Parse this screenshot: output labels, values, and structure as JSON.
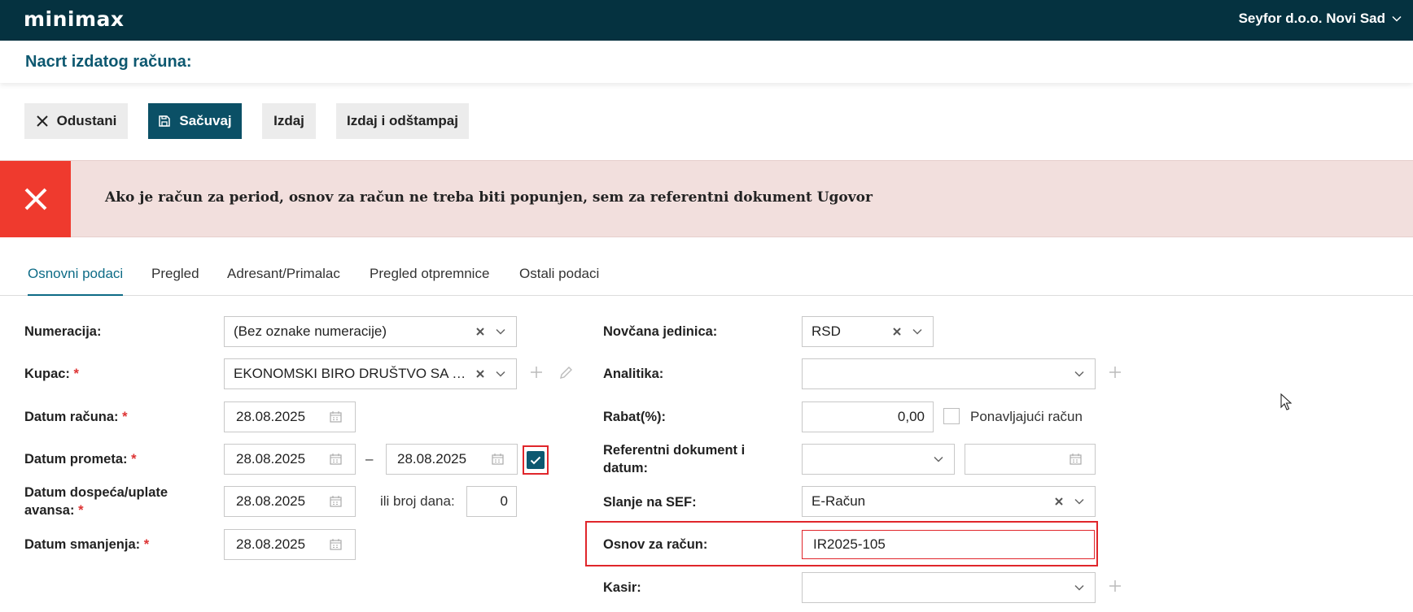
{
  "app": {
    "logo": "minimax",
    "company": "Seyfor d.o.o. Novi Sad",
    "page_title": "Nacrt izdatog računa:"
  },
  "toolbar": {
    "cancel_label": "Odustani",
    "save_label": "Sačuvaj",
    "issue_label": "Izdaj",
    "issue_print_label": "Izdaj i odštampaj"
  },
  "error": {
    "message": "Ako je račun za period, osnov za račun ne treba biti popunjen, sem za referentni dokument Ugovor"
  },
  "tabs": [
    {
      "label": "Osnovni podaci",
      "active": true
    },
    {
      "label": "Pregled",
      "active": false
    },
    {
      "label": "Adresant/Primalac",
      "active": false
    },
    {
      "label": "Pregled otpremnice",
      "active": false
    },
    {
      "label": "Ostali podaci",
      "active": false
    }
  ],
  "form": {
    "numeracija": {
      "label": "Numeracija:",
      "value": "(Bez oznake numeracije)"
    },
    "kupac": {
      "label": "Kupac:",
      "required": "*",
      "value": "EKONOMSKI BIRO DRUŠTVO SA OGR..."
    },
    "datum_racuna": {
      "label": "Datum računa:",
      "required": "*",
      "value": "28.08.2025"
    },
    "datum_prometa": {
      "label": "Datum prometa:",
      "required": "*",
      "from": "28.08.2025",
      "separator": "–",
      "to": "28.08.2025",
      "checked": true
    },
    "datum_dospeca": {
      "label_line1": "Datum dospeća/uplate",
      "label_line2": "avansa:",
      "required": "*",
      "value": "28.08.2025",
      "days_label": "ili broj dana:",
      "days": "0"
    },
    "datum_smanjenja": {
      "label": "Datum smanjenja:",
      "required": "*",
      "value": "28.08.2025"
    },
    "novcana_jedinica": {
      "label": "Novčana jedinica:",
      "value": "RSD"
    },
    "analitika": {
      "label": "Analitika:",
      "value": ""
    },
    "rabat": {
      "label": "Rabat(%):",
      "value": "0,00",
      "recurring_label": "Ponavljajući račun",
      "recurring_checked": false
    },
    "referentni": {
      "label_line1": "Referentni dokument i",
      "label_line2": "datum:",
      "value": "",
      "date": ""
    },
    "slanje_sef": {
      "label": "Slanje na SEF:",
      "value": "E-Račun"
    },
    "osnov": {
      "label": "Osnov za račun:",
      "value": "IR2025-105"
    },
    "kasir": {
      "label": "Kasir:",
      "value": ""
    }
  },
  "colors": {
    "topbar": "#053240",
    "primary": "#0b5066",
    "accent": "#0d6b86",
    "error": "#ef3a2e",
    "error_bg": "#f2dfdd",
    "highlight": "#e0262b"
  }
}
